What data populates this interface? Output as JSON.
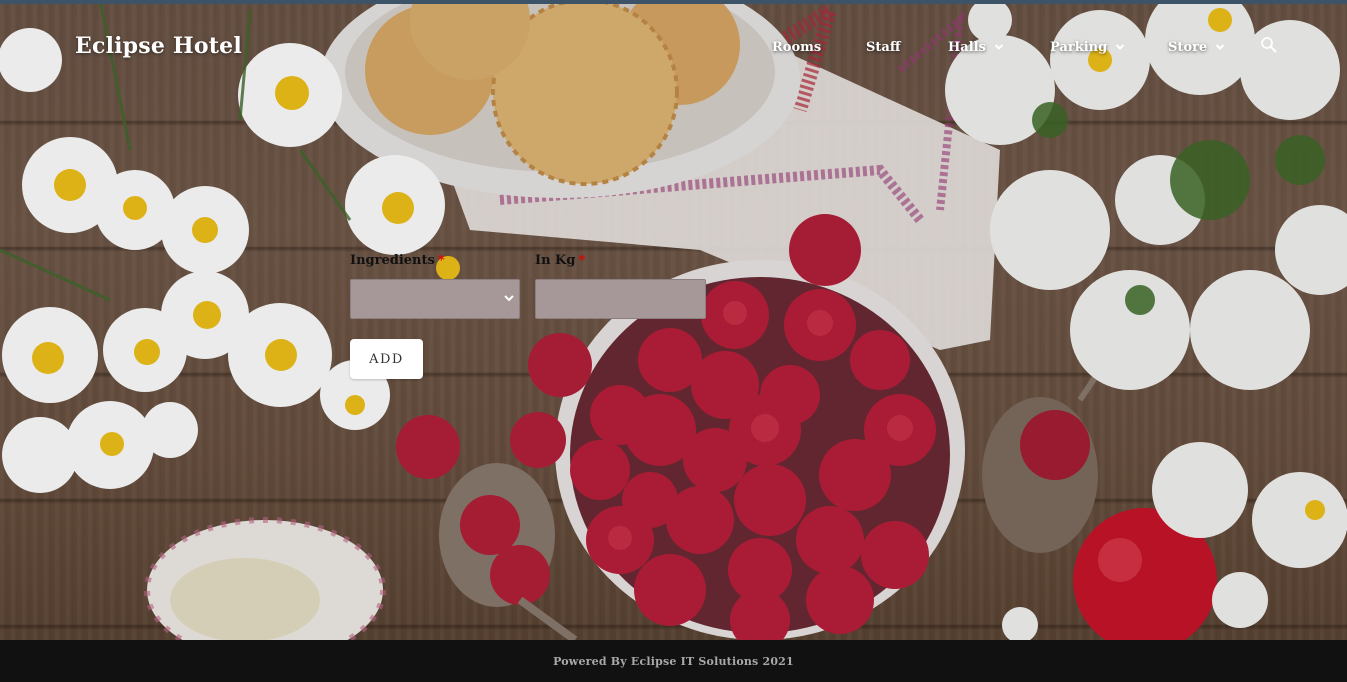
{
  "brand": {
    "title": "Eclipse Hotel"
  },
  "nav": {
    "items": [
      {
        "label": "Rooms",
        "has_dropdown": false
      },
      {
        "label": "Staff",
        "has_dropdown": false
      },
      {
        "label": "Halls",
        "has_dropdown": true
      },
      {
        "label": "Parking",
        "has_dropdown": true
      },
      {
        "label": "Store",
        "has_dropdown": true
      }
    ],
    "search_icon": "search-icon"
  },
  "form": {
    "ingredients_label": "Ingredients",
    "kg_label": "In Kg",
    "required_marker": "*",
    "ingredients_value": "",
    "kg_value": "",
    "add_label": "ADD"
  },
  "footer": {
    "text": "Powered By Eclipse IT Solutions 2021"
  },
  "colors": {
    "input_bg": "#a69898",
    "required": "#e00000",
    "footer_bg": "#111111",
    "footer_text": "#a8a8a8",
    "accent_strip": "#3d5468"
  }
}
